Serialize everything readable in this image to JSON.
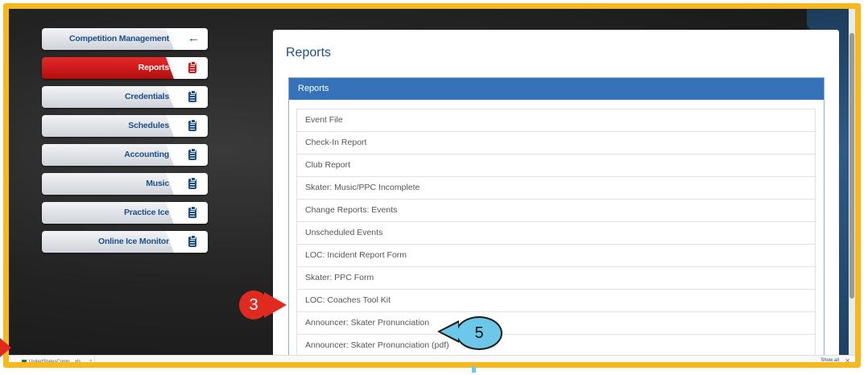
{
  "sidebar": {
    "items": [
      {
        "label": "Competition Management",
        "icon": "arrow-left-icon"
      },
      {
        "label": "Reports",
        "icon": "clipboard-icon",
        "active": true
      },
      {
        "label": "Credentials",
        "icon": "clipboard-icon"
      },
      {
        "label": "Schedules",
        "icon": "clipboard-icon"
      },
      {
        "label": "Accounting",
        "icon": "clipboard-icon"
      },
      {
        "label": "Music",
        "icon": "clipboard-icon"
      },
      {
        "label": "Practice Ice",
        "icon": "clipboard-icon"
      },
      {
        "label": "Online Ice Monitor",
        "icon": "clipboard-icon"
      }
    ],
    "back_arrow": "←"
  },
  "main": {
    "title": "Reports",
    "card_title": "Reports",
    "reports": [
      "Event File",
      "Check-In Report",
      "Club Report",
      "Skater: Music/PPC Incomplete",
      "Change Reports: Events",
      "Unscheduled Events",
      "LOC: Incident Report Form",
      "Skater: PPC Form",
      "LOC: Coaches Tool Kit",
      "Announcer: Skater Pronunciation",
      "Announcer: Skater Pronunciation (pdf)"
    ]
  },
  "download_bar": {
    "file_name": "UnitedStatesComp....xls",
    "chevron": "^",
    "show_all": "Show all",
    "close": "✕"
  },
  "callouts": {
    "step3": "3",
    "step5": "5"
  },
  "colors": {
    "frame": "#f7b81b",
    "accent": "#1d4f8a",
    "active": "#d21b1b",
    "header": "#3572b8",
    "callout_red": "#e02a1f",
    "callout_blue": "#6cc8e8"
  }
}
